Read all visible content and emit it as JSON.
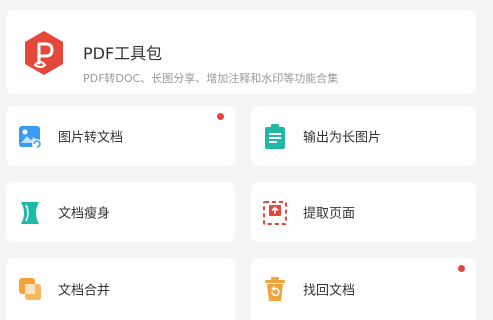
{
  "header": {
    "title": "PDF工具包",
    "subtitle": "PDF转DOC、长图分享、增加注释和水印等功能合集",
    "icon": "pdf-logo-icon",
    "brand_color": "#e5483b"
  },
  "tools": [
    {
      "label": "图片转文档",
      "icon": "image-convert-icon",
      "badge": true
    },
    {
      "label": "输出为长图片",
      "icon": "long-image-icon",
      "badge": false
    },
    {
      "label": "文档瘦身",
      "icon": "compress-icon",
      "badge": false
    },
    {
      "label": "提取页面",
      "icon": "extract-page-icon",
      "badge": false
    },
    {
      "label": "文档合并",
      "icon": "merge-icon",
      "badge": false
    },
    {
      "label": "找回文档",
      "icon": "recover-icon",
      "badge": true
    }
  ],
  "colors": {
    "blue": "#3a9bf2",
    "teal": "#1fb9a8",
    "red": "#e5483b",
    "orange": "#f4a23a",
    "badge": "#e5483b"
  }
}
